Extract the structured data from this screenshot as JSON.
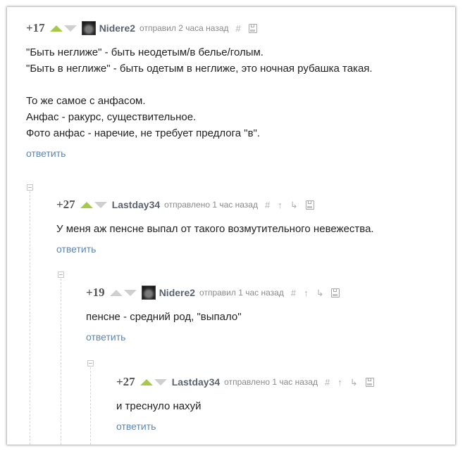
{
  "comments": [
    {
      "rating": "+17",
      "author": "Nidere2",
      "time": "отправил 2 часа назад",
      "lines": [
        "\"Быть неглиже\" - быть неодетым/в белье/голым.",
        "\"Быть в неглиже\" - быть одетым в неглиже, это ночная рубашка такая.",
        "",
        "То же самое с анфасом.",
        "Анфас - ракурс, существительное.",
        "Фото анфас - наречие, не требует предлога \"в\"."
      ],
      "reply": "ответить"
    },
    {
      "rating": "+27",
      "author": "Lastday34",
      "time": "отправлено 1 час назад",
      "lines": [
        "У меня аж пенсне выпал от такого возмутительного невежества."
      ],
      "reply": "ответить"
    },
    {
      "rating": "+19",
      "author": "Nidere2",
      "time": "отправил 1 час назад",
      "lines": [
        "пенсне - средний род, \"выпало\""
      ],
      "reply": "ответить"
    },
    {
      "rating": "+27",
      "author": "Lastday34",
      "time": "отправлено 1 час назад",
      "lines": [
        "и треснуло нахуй"
      ],
      "reply": "ответить"
    }
  ],
  "icons": {
    "hash": "#",
    "parent": "↑",
    "branch": "↳"
  },
  "colors": {
    "upvote": "#a7c94b",
    "inactive_vote": "#cfcfcf",
    "reply_link": "#5b86b3",
    "author": "#5a6370"
  }
}
